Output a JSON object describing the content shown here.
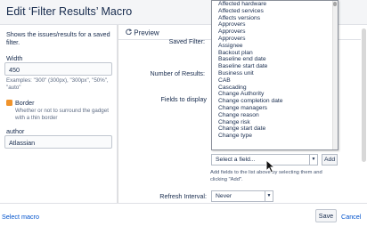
{
  "header": {
    "title": "Edit ‘Filter Results’ Macro"
  },
  "left": {
    "description": "Shows the issues/results for a saved filter.",
    "width_label": "Width",
    "width_value": "450",
    "width_hint": "Examples: \"300\" (300px), \"300px\", \"50%\", \"auto\"",
    "border_label": "Border",
    "border_hint": "Whether or not to surround the gadget with a thin border",
    "author_label": "author",
    "author_value": "Atlassian"
  },
  "preview": {
    "tab_label": "Preview",
    "saved_filter_label": "Saved Filter:",
    "number_results_label": "Number of Results:",
    "fields_label": "Fields to display",
    "field_select_placeholder": "Select a field...",
    "add_label": "Add",
    "add_helper": "Add fields to the list above by selecting them and clicking \"Add\".",
    "refresh_label": "Refresh Interval:",
    "refresh_value": "Never"
  },
  "dropdown": {
    "options": [
      "Affected hardware",
      "Affected services",
      "Affects versions",
      "Approvers",
      "Approvers",
      "Approvers",
      "Assignee",
      "Backout plan",
      "Baseline end date",
      "Baseline start date",
      "Business unit",
      "CAB",
      "Cascading",
      "Change Authority",
      "Change completion date",
      "Change managers",
      "Change reason",
      "Change risk",
      "Change start date",
      "Change type"
    ]
  },
  "footer": {
    "select_macro": "Select macro",
    "save": "Save",
    "cancel": "Cancel"
  },
  "colors": {
    "accent": "#f0932b",
    "link": "#0052cc"
  }
}
